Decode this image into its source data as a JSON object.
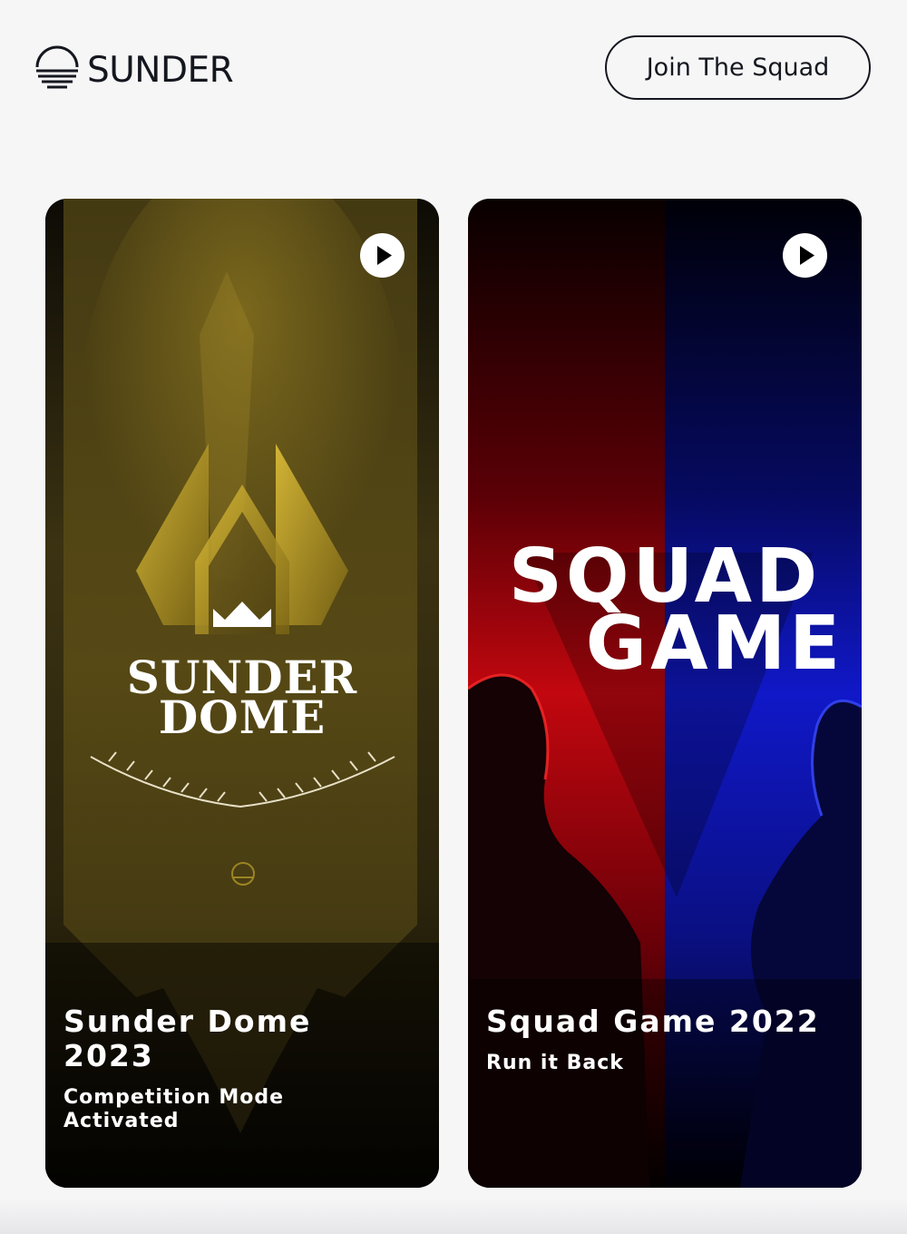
{
  "header": {
    "logo_text": "SUNDER",
    "cta_label": "Join The Squad"
  },
  "cards": [
    {
      "poster_title_line1": "SUNDER",
      "poster_title_line2": "DOME",
      "title": "Sunder Dome\n2023",
      "subtitle": "Competition Mode\nActivated",
      "play_icon": "play-icon",
      "accent": "#c9a227"
    },
    {
      "poster_title_line1": "SQUAD",
      "poster_title_line2": "GAME",
      "title": "Squad Game 2022",
      "subtitle": "Run it Back",
      "play_icon": "play-icon",
      "accent_left": "#e0141c",
      "accent_right": "#1020d8"
    }
  ]
}
